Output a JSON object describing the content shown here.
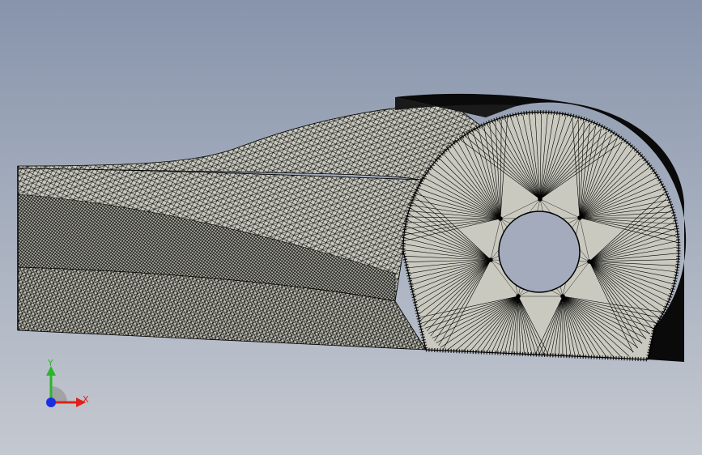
{
  "viewport": {
    "model": "cut-mesh-solid",
    "mesh_visible": true,
    "background_colors": [
      "#8794ab",
      "#c4c8d0"
    ],
    "face_color": "#c9c9bf",
    "edge_color": "#000000"
  },
  "triad": {
    "x_label": "X",
    "y_label": "Y",
    "x_color": "#e0201a",
    "y_color": "#2ab52a",
    "z_color": "#1a2fe0"
  }
}
